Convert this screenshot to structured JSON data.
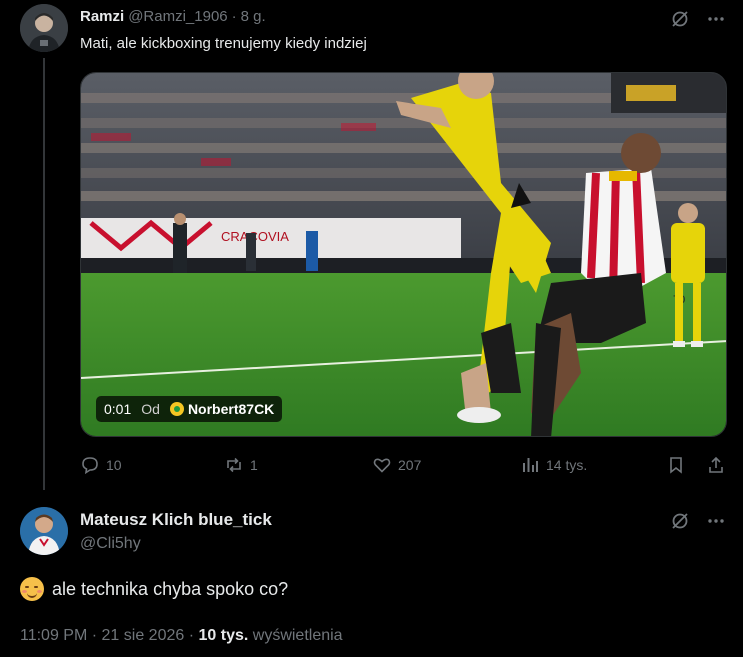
{
  "colors": {
    "background": "#000000",
    "text": "#e7e9ea",
    "muted": "#71767b",
    "divider": "#333639",
    "pitch": "#3e8e2a",
    "kit_yellow": "#e6d40a",
    "kit_stripe_red": "#c8102e"
  },
  "reply": {
    "author_name": "Ramzi",
    "handle": "@Ramzi_1906",
    "separator": "·",
    "time": "8 g.",
    "text": "Mati, ale kickboxing trenujemy kiedy indziej",
    "icons": [
      "grok-slash-icon",
      "more-icon"
    ],
    "video": {
      "elapsed": "0:01",
      "from_label": "Od",
      "from_user": "Norbert87CK",
      "banner_text": "CRACOVIA"
    },
    "actions": {
      "replies": "10",
      "reposts": "1",
      "likes": "207",
      "views": "14 tys."
    }
  },
  "main_post": {
    "author_name": "Mateusz Klich blue_tick",
    "handle": "@Cli5hy",
    "text": "ale technika chyba spoko co?",
    "emoji": "smiling-blush-emoji",
    "time": "11:09 PM",
    "dot": "·",
    "date": "21 sie 2026",
    "views_count": "10 tys.",
    "views_label": "wyświetlenia"
  }
}
